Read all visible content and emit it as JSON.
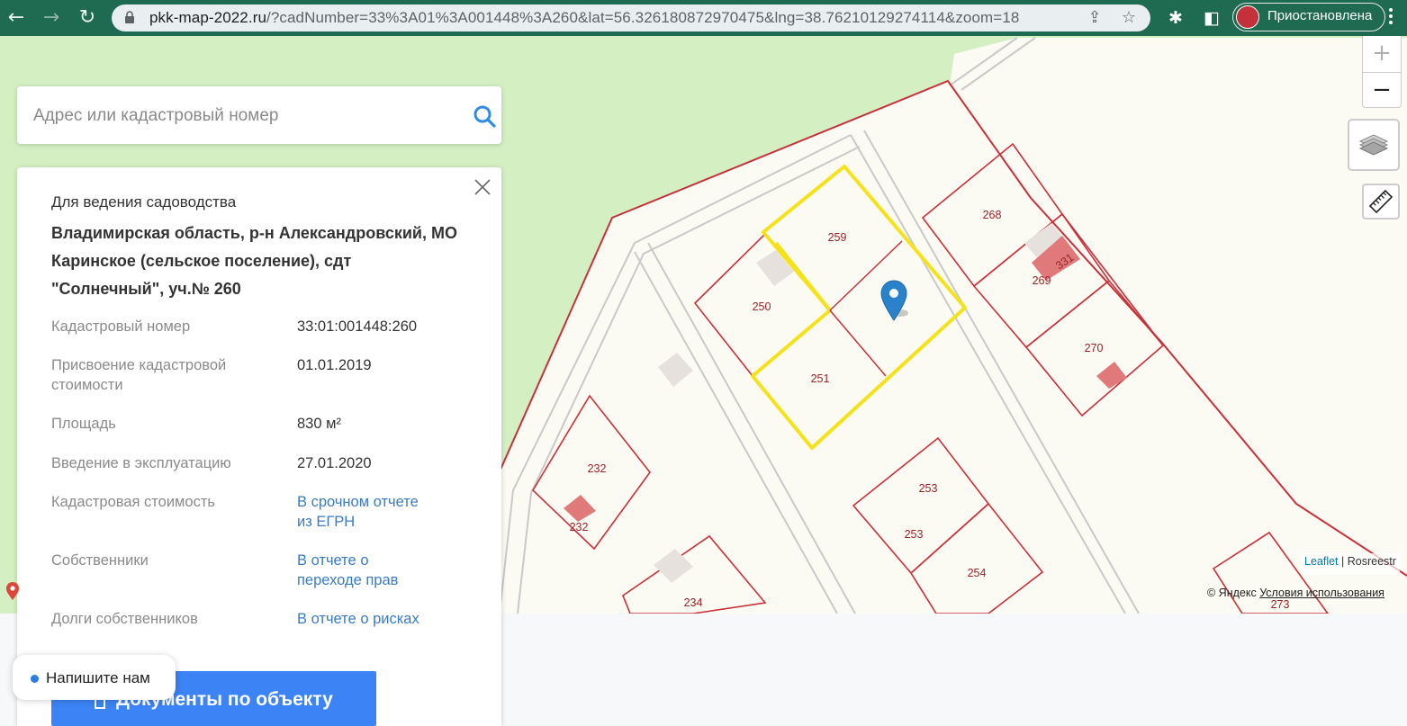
{
  "browser": {
    "url_host": "pkk-map-2022.ru",
    "url_path": "/?cadNumber=33%3A01%3A001448%3A260&lat=56.326180872970475&lng=38.76210129274114&zoom=18",
    "profile_label": "Приостановлена"
  },
  "search": {
    "placeholder": "Адрес или кадастровый номер"
  },
  "panel": {
    "purpose": "Для ведения садоводства",
    "address": "Владимирская область, р-н Александровский, МО Каринское (сельское поселение), сдт \"Солнечный\", уч.№ 260",
    "fields": [
      {
        "label": "Кадастровый номер",
        "value": "33:01:001448:260"
      },
      {
        "label": "Присвоение кадастровой стоимости",
        "value": "01.01.2019"
      },
      {
        "label": "Площадь",
        "value": "830 м²"
      },
      {
        "label": "Введение в эксплуатацию",
        "value": "27.01.2020"
      },
      {
        "label": "Кадастровая стоимость",
        "value": "В срочном отчете из ЕГРН"
      },
      {
        "label": "Собственники",
        "value": "В отчете о переходе прав"
      },
      {
        "label": "Долги собственников",
        "value": "В отчете о рисках"
      }
    ],
    "documents_button": "Документы по объекту"
  },
  "chat": {
    "label": "Напишите нам"
  },
  "map": {
    "zoom_in": "+",
    "zoom_out": "−",
    "attribution_leaflet": "Leaflet",
    "attribution_rosreestr": "| Rosreestr",
    "yandex_prefix": "© Яндекс",
    "yandex_terms": "Условия использования",
    "parcel_labels": [
      "259",
      "250",
      "251",
      "268",
      "269",
      "331",
      "270",
      "232",
      "232",
      "234",
      "253",
      "253",
      "254",
      "273"
    ],
    "colors": {
      "parcel_border": "#c8303a",
      "selected": "#f5e21b",
      "building": "#e07a7a",
      "meadow": "#d4f0c2",
      "ground": "#fbfbf3"
    }
  }
}
